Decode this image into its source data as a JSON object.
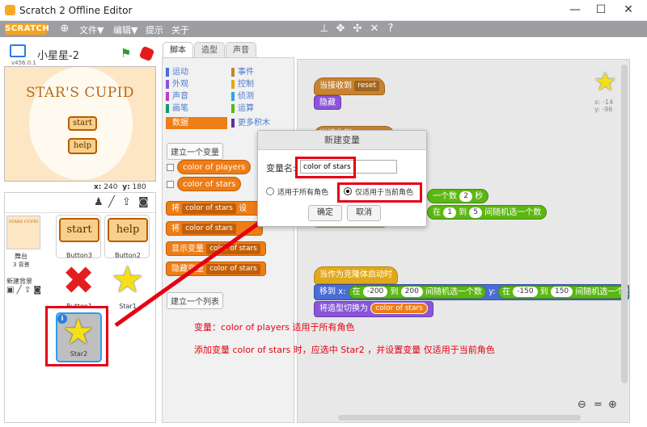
{
  "window": {
    "title": "Scratch 2 Offline Editor"
  },
  "menubar": {
    "logo": "SCRATCH",
    "menus": [
      "文件▼",
      "编辑▼",
      "提示",
      "关于"
    ]
  },
  "project": {
    "name": "小星星-2",
    "version": "v456.0.1"
  },
  "stage_view": {
    "title": "STAR'S CUPID",
    "btn_start": "start",
    "btn_help": "help",
    "coords_x_label": "x:",
    "coords_x": "240",
    "coords_y_label": "y:",
    "coords_y": "180"
  },
  "sprites": {
    "stage_label": "舞台",
    "stage_backdrops": "3 背景",
    "new_backdrop": "新建背景",
    "stage_thumb_text": "STARS CUPID",
    "items": [
      {
        "name": "Button3",
        "text": "start"
      },
      {
        "name": "Button2",
        "text": "help"
      },
      {
        "name": "Button1"
      },
      {
        "name": "Star1"
      },
      {
        "name": "Star2",
        "info": "i"
      }
    ]
  },
  "tabs": {
    "scripts": "脚本",
    "costumes": "造型",
    "sounds": "声音"
  },
  "categories": [
    {
      "label": "运动",
      "color": "#4a6cd4"
    },
    {
      "label": "外观",
      "color": "#8a55d7"
    },
    {
      "label": "声音",
      "color": "#bb42c3"
    },
    {
      "label": "画笔",
      "color": "#0e9a6c"
    },
    {
      "label": "数据",
      "color": "#ee7d16"
    },
    {
      "label": "事件",
      "color": "#c88330"
    },
    {
      "label": "控制",
      "color": "#e1a91a"
    },
    {
      "label": "侦测",
      "color": "#2ca5e2"
    },
    {
      "label": "运算",
      "color": "#5cb712"
    },
    {
      "label": "更多积木",
      "color": "#632d99"
    }
  ],
  "palette": {
    "make_variable": "建立一个变量",
    "var1": "color of players",
    "var2": "color of stars",
    "set_prefix": "将",
    "set_var": "color of stars",
    "set_suffix": "设",
    "change_prefix": "将",
    "change_var": "color of stars",
    "show_var": "显示变量",
    "show_var_name": "color of stars",
    "hide_var": "隐藏变量",
    "hide_var_name": "color of stars",
    "make_list": "建立一个列表"
  },
  "scripts": {
    "when_receive": "当接收到",
    "receive_msg": "reset",
    "hide": "隐藏",
    "when_receive2": "当接收到",
    "clone_start": "当作为克隆体启动时",
    "move_to": "移到 x:",
    "in1": "在",
    "x_from": "-200",
    "to1": "到",
    "x_to": "200",
    "rand1": "间随机选一个数",
    "y_label": "y:",
    "in2": "在",
    "y_from": "-150",
    "to2": "到",
    "y_to": "150",
    "rand2": "间随机选一个数",
    "switch_costume": "将造型切换为",
    "costume_var": "color of stars",
    "frag_rand": "一个数",
    "frag_num": "2",
    "frag_sec": "秒",
    "frag_in": "在",
    "frag_n1": "1",
    "frag_to": "到",
    "frag_n2": "5",
    "frag_rand2": "间随机选一个数",
    "sprite_x_label": "x:",
    "sprite_x": "-14",
    "sprite_y_label": "y:",
    "sprite_y": "-96"
  },
  "dialog": {
    "title": "新建变量",
    "name_label": "变量名:",
    "name_value": "color of stars",
    "opt_all": "适用于所有角色",
    "opt_this": "仅适用于当前角色",
    "ok": "确定",
    "cancel": "取消"
  },
  "annotations": {
    "line1": "变量：color of players 适用于所有角色",
    "line2": "添加变量 color of stars 时，应选中 Star2 ，并设置变量 仅适用于当前角色"
  },
  "colors": {
    "accent_red": "#e60012",
    "menubar": "#9c9ea2",
    "scratch_orange": "#f7a41d"
  }
}
